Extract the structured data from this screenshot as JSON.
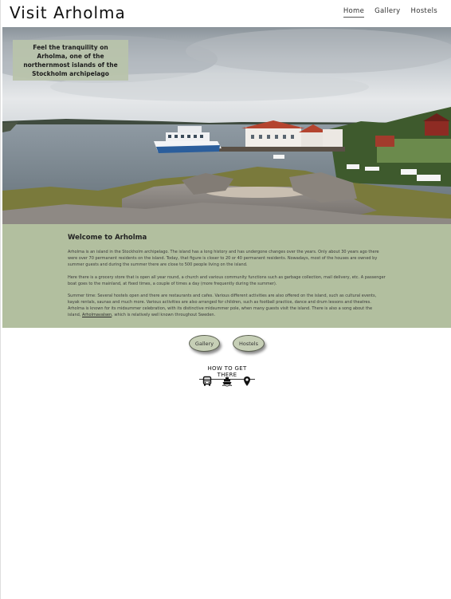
{
  "header": {
    "logo": "Visit Arholma",
    "nav": [
      {
        "label": "Home",
        "active": true
      },
      {
        "label": "Gallery",
        "active": false
      },
      {
        "label": "Hostels",
        "active": false
      }
    ]
  },
  "hero": {
    "caption": "Feel the tranquility on Arholma, one of the northernmost islands of the Stockholm archipelago"
  },
  "welcome": {
    "title": "Welcome to Arholma",
    "paragraph_1": "Arholma is an island in the Stockholm archipelago. The island has a long history and has undergone changes over the years. Only about 30 years ago there were over 70 permanent residents on the island. Today, that figure is closer to 20 or 40 permanent residents. Nowadays, most of the houses are owned by summer guests and during the summer there are close to 500 people living on the island.",
    "paragraph_2": "Here there is a grocery store that is open all year round, a church and various community functions such as garbage collection, mail delivery, etc. A passenger boat goes to the mainland, at fixed times, a couple of times a day (more frequently during the summer).",
    "paragraph_3_start": "Summer time: Several hostels open and there are restaurants and cafes. Various different activities are also offered on the island, such as cultural events, kayak rentals, saunas and much more. Various activities are also arranged for children, such as football practice, dance and drum lessons and theatres. Arholma is known for its midsummer celebration, with its distinctive midsummer pole, when many guests visit the island. There is also a song about the island, ",
    "song_link": "Arholmavalsen",
    "paragraph_3_end": ", which is relatively well known throughout Sweden."
  },
  "buttons": {
    "gallery": "Gallery",
    "hostels": "Hostels"
  },
  "how_to": {
    "title": "HOW TO GET THERE",
    "icons": [
      "bus-icon",
      "ferry-icon",
      "location-pin-icon"
    ]
  }
}
